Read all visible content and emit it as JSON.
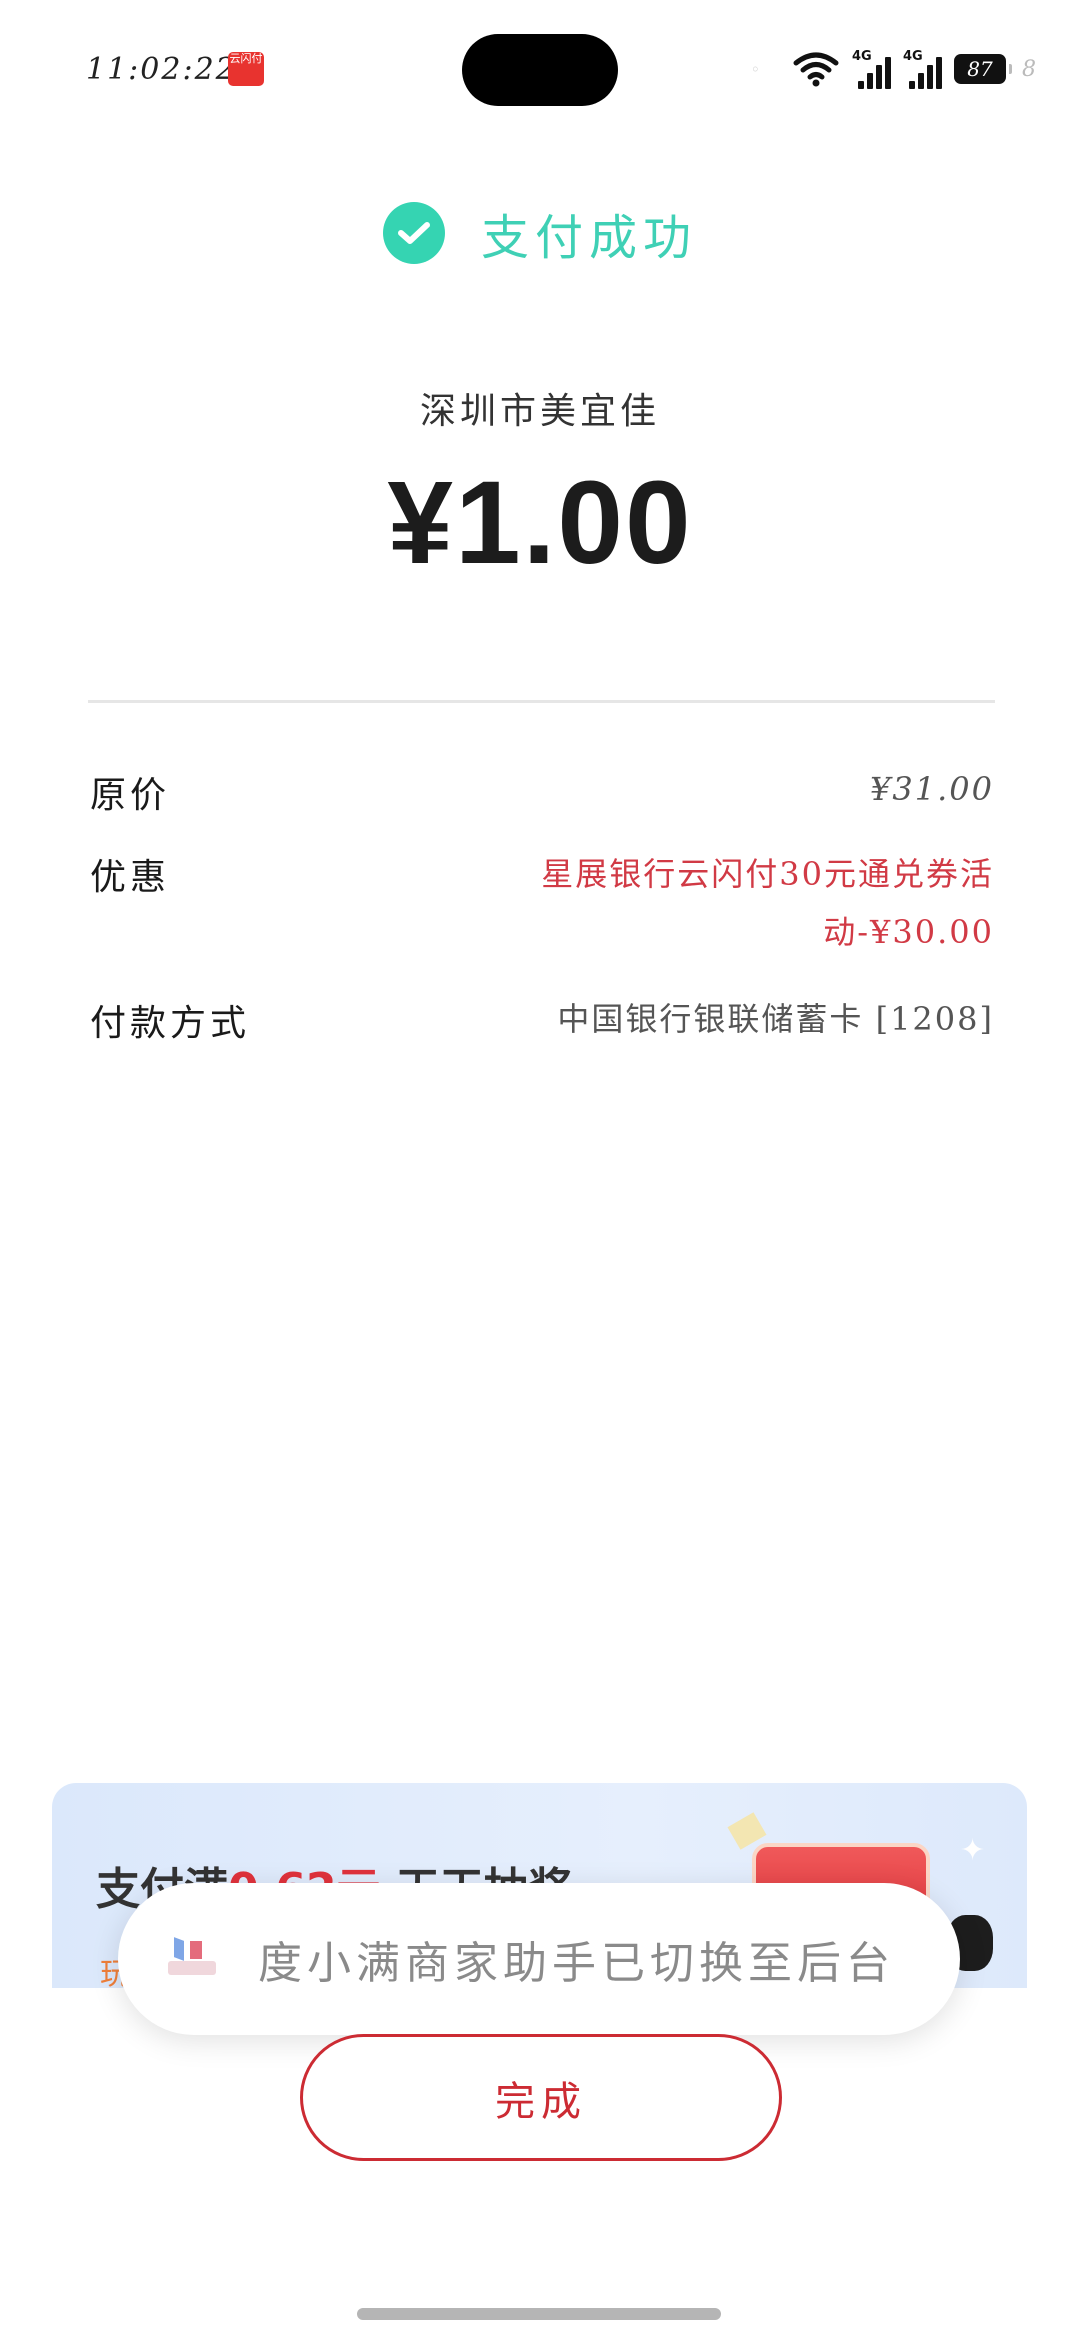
{
  "status_bar": {
    "time": "11:02:22",
    "app_badge": "云闪付",
    "faint": "◦",
    "net1": "4G",
    "net2": "4G",
    "battery": "87",
    "trailing": "8"
  },
  "header": {
    "success_text": "支付成功"
  },
  "payment": {
    "merchant": "深圳市美宜佳",
    "amount": "¥1.00"
  },
  "details": {
    "original_label": "原价",
    "original_value": "¥31.00",
    "discount_label": "优惠",
    "discount_line1": "星展银行云闪付30元通兑券活",
    "discount_line2": "动-¥30.00",
    "method_label": "付款方式",
    "method_value": "中国银行银联储蓄卡 [1208]"
  },
  "promo": {
    "title_prefix": "支付满",
    "title_highlight": "0.62元",
    "title_suffix": " 天天抽奖",
    "subtitle": "玩"
  },
  "toast": {
    "text": "度小满商家助手已切换至后台"
  },
  "actions": {
    "done_label": "完成"
  },
  "colors": {
    "success": "#3fd0b5",
    "discount": "#d13a45",
    "button": "#cc2b33"
  }
}
